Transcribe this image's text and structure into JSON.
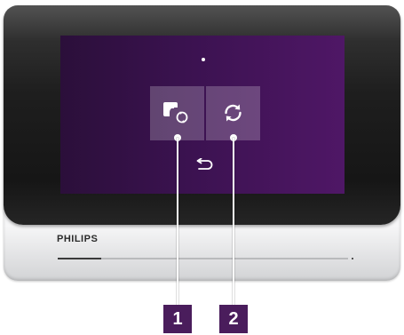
{
  "device": {
    "brand": "PHILIPS",
    "slider_level": 0.15
  },
  "screen": {
    "buttons": [
      {
        "icon": "rotate-screen-icon"
      },
      {
        "icon": "sync-icon"
      }
    ],
    "back_icon": "back-arrow-icon"
  },
  "callouts": [
    {
      "label": "1"
    },
    {
      "label": "2"
    }
  ],
  "colors": {
    "screen_bg_left": "#2b0f3a",
    "screen_bg_right": "#4f1766",
    "callout_box": "#4a1d5c",
    "tile": "#ffffff38"
  }
}
